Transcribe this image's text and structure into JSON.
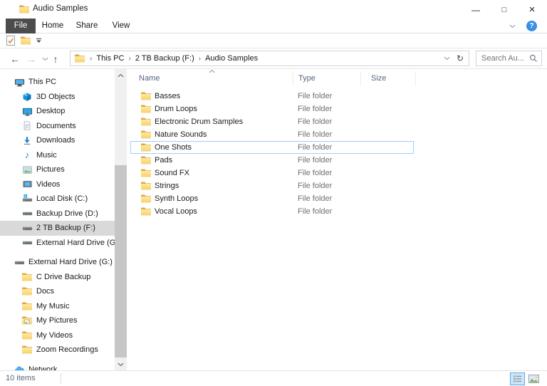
{
  "window": {
    "title": "Audio Samples",
    "controls": {
      "minimize": "—",
      "maximize": "□",
      "close": "×"
    }
  },
  "ribbon": {
    "tabs": [
      {
        "label": "File",
        "active": true
      },
      {
        "label": "Home",
        "active": false
      },
      {
        "label": "Share",
        "active": false
      },
      {
        "label": "View",
        "active": false
      }
    ]
  },
  "qat": {
    "buttons": [
      {
        "name": "properties-button",
        "icon": "properties"
      },
      {
        "name": "new-folder-button",
        "icon": "folder"
      },
      {
        "name": "customize-toolbar-button",
        "icon": "caret-bar"
      }
    ]
  },
  "navigation": {
    "back": {
      "glyph": "←",
      "enabled": true
    },
    "forward": {
      "glyph": "→",
      "enabled": false
    },
    "up": {
      "glyph": "↑",
      "enabled": true
    },
    "refresh_glyph": "↻"
  },
  "address": {
    "separator": "›",
    "crumbs": [
      "This PC",
      "2 TB Backup (F:)",
      "Audio Samples"
    ]
  },
  "search": {
    "placeholder": "Search Au..."
  },
  "sidebar": {
    "items": [
      {
        "label": "This PC",
        "icon": "computer",
        "level": 0
      },
      {
        "label": "3D Objects",
        "icon": "cube",
        "level": 1
      },
      {
        "label": "Desktop",
        "icon": "monitor",
        "level": 1
      },
      {
        "label": "Documents",
        "icon": "document",
        "level": 1
      },
      {
        "label": "Downloads",
        "icon": "download-arrow",
        "level": 1
      },
      {
        "label": "Music",
        "icon": "music-note",
        "level": 1
      },
      {
        "label": "Pictures",
        "icon": "picture",
        "level": 1
      },
      {
        "label": "Videos",
        "icon": "video",
        "level": 1
      },
      {
        "label": "Local Disk (C:)",
        "icon": "os-drive",
        "level": 1
      },
      {
        "label": "Backup Drive (D:)",
        "icon": "drive",
        "level": 1
      },
      {
        "label": "2 TB Backup (F:)",
        "icon": "drive",
        "level": 1,
        "selected": true
      },
      {
        "label": "External Hard Drive (G:)",
        "icon": "drive",
        "level": 1
      },
      {
        "label": "External Hard Drive (G:)",
        "icon": "drive",
        "level": 0,
        "gap_before": true
      },
      {
        "label": "C Drive Backup",
        "icon": "folder",
        "level": 1
      },
      {
        "label": "Docs",
        "icon": "folder",
        "level": 1
      },
      {
        "label": "My Music",
        "icon": "folder",
        "level": 1
      },
      {
        "label": "My Pictures",
        "icon": "folder-pictures",
        "level": 1
      },
      {
        "label": "My Videos",
        "icon": "folder",
        "level": 1
      },
      {
        "label": "Zoom Recordings",
        "icon": "folder",
        "level": 1
      },
      {
        "label": "Network",
        "icon": "network",
        "level": 0,
        "gap_before": true
      }
    ]
  },
  "files": {
    "columns": [
      {
        "label": "Name",
        "sort": "asc"
      },
      {
        "label": "Type"
      },
      {
        "label": "Size"
      }
    ],
    "rows": [
      {
        "name": "Basses",
        "type": "File folder",
        "size": ""
      },
      {
        "name": "Drum Loops",
        "type": "File folder",
        "size": ""
      },
      {
        "name": "Electronic Drum Samples",
        "type": "File folder",
        "size": ""
      },
      {
        "name": "Nature Sounds",
        "type": "File folder",
        "size": ""
      },
      {
        "name": "One Shots",
        "type": "File folder",
        "size": "",
        "selected": true
      },
      {
        "name": "Pads",
        "type": "File folder",
        "size": ""
      },
      {
        "name": "Sound FX",
        "type": "File folder",
        "size": ""
      },
      {
        "name": "Strings",
        "type": "File folder",
        "size": ""
      },
      {
        "name": "Synth Loops",
        "type": "File folder",
        "size": ""
      },
      {
        "name": "Vocal Loops",
        "type": "File folder",
        "size": ""
      }
    ]
  },
  "statusbar": {
    "count": "10 items",
    "view_toggles": [
      {
        "name": "details-view",
        "active": true
      },
      {
        "name": "thumbnails-view",
        "active": false
      }
    ]
  },
  "colors": {
    "accent": "#0078d7",
    "file_tab_bg": "#4c4c4c",
    "selection_outline": "#99d1ff",
    "sidebar_selection": "#d9d9d9",
    "folder_yellow": "#f6d26b",
    "help_blue": "#3a8ee6"
  }
}
